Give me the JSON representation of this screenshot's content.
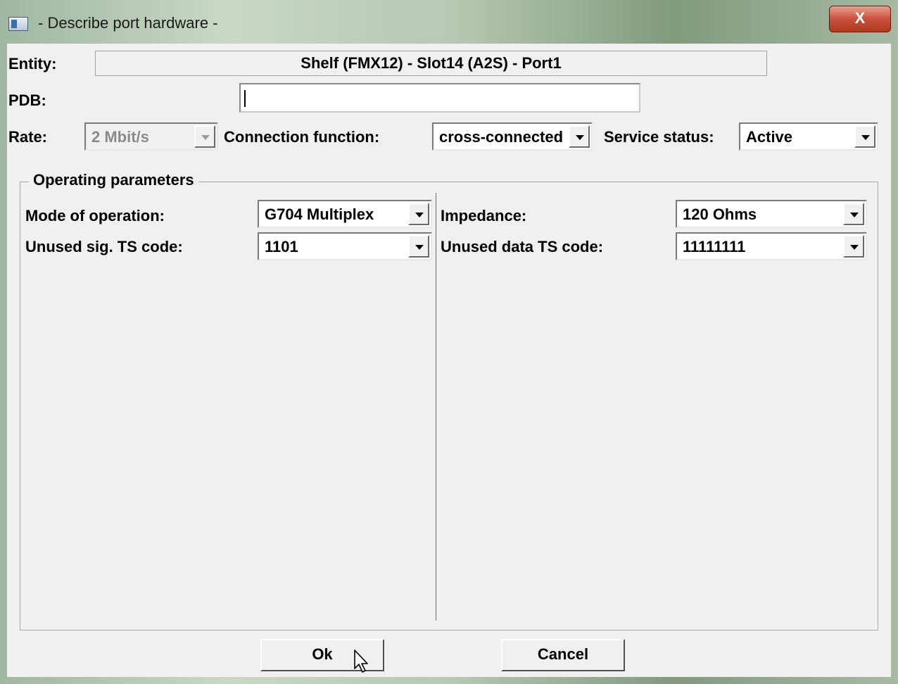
{
  "window": {
    "title": "- Describe port hardware -",
    "close_label": "X"
  },
  "entity": {
    "label": "Entity:",
    "value": "Shelf (FMX12) - Slot14 (A2S) - Port1"
  },
  "pdb": {
    "label": "PDB:",
    "value": ""
  },
  "rate": {
    "label": "Rate:",
    "value": "2 Mbit/s"
  },
  "connection_function": {
    "label": "Connection function:",
    "value": "cross-connected"
  },
  "service_status": {
    "label": "Service status:",
    "value": "Active"
  },
  "operating_parameters": {
    "title": "Operating parameters",
    "mode_of_operation": {
      "label": "Mode of operation:",
      "value": "G704 Multiplex"
    },
    "unused_sig_ts_code": {
      "label": "Unused sig. TS code:",
      "value": "1101"
    },
    "impedance": {
      "label": "Impedance:",
      "value": "120 Ohms"
    },
    "unused_data_ts_code": {
      "label": "Unused data TS code:",
      "value": "11111111"
    }
  },
  "buttons": {
    "ok": "Ok",
    "cancel": "Cancel"
  },
  "icons": {
    "app": "app-window-icon",
    "close": "close-icon",
    "cursor": "mouse-pointer-icon"
  }
}
